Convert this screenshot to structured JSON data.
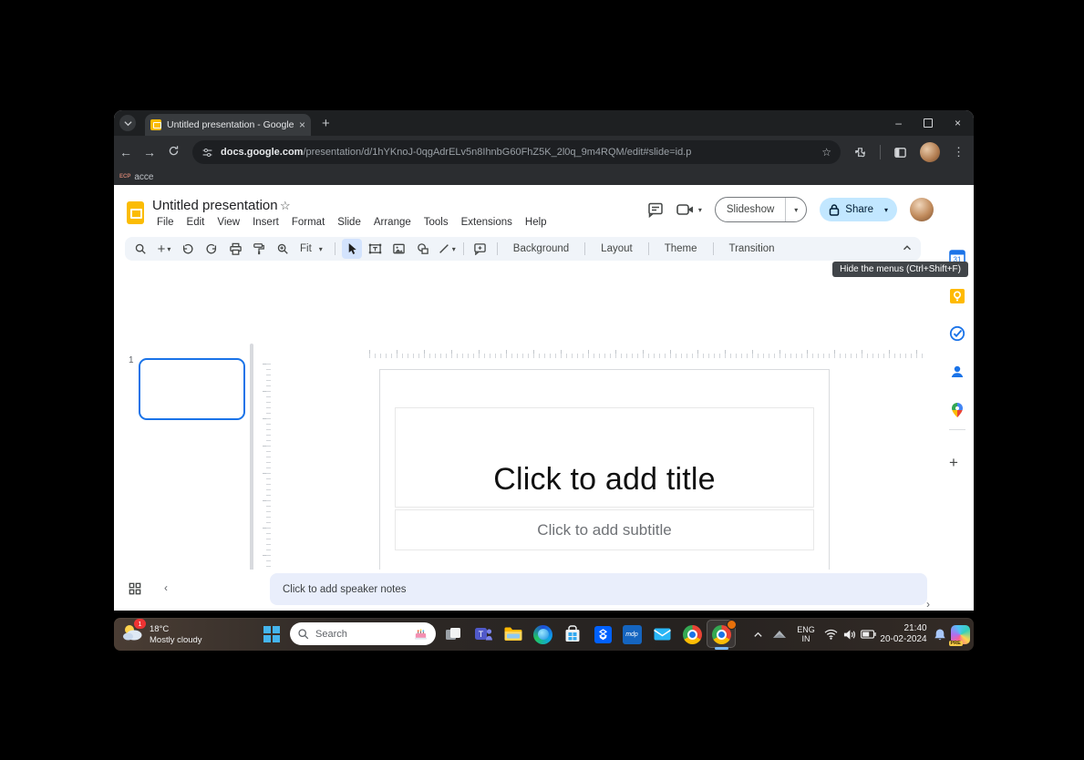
{
  "browser": {
    "tab_title": "Untitled presentation - Google",
    "tab_close": "×",
    "new_tab": "+",
    "url_domain": "docs.google.com",
    "url_path": "/presentation/d/1hYKnoJ-0qgAdrELv5n8IhnbG60FhZ5K_2l0q_9m4RQM/edit#slide=id.p",
    "bookmark_favicon": "ECP",
    "bookmark_label": "acce",
    "minimize": "–",
    "close": "×"
  },
  "slides": {
    "doc_title": "Untitled presentation",
    "star": "☆",
    "menus": [
      "File",
      "Edit",
      "View",
      "Insert",
      "Format",
      "Slide",
      "Arrange",
      "Tools",
      "Extensions",
      "Help"
    ],
    "slideshow_label": "Slideshow",
    "share_label": "Share",
    "zoom_value": "Fit",
    "toolbar_buttons": [
      "Background",
      "Layout",
      "Theme",
      "Transition"
    ],
    "hide_menus_tooltip": "Hide the menus (Ctrl+Shift+F)",
    "slide_number": "1",
    "title_placeholder": "Click to add title",
    "subtitle_placeholder": "Click to add subtitle",
    "notes_placeholder": "Click to add speaker notes",
    "calendar_day": "31"
  },
  "taskbar": {
    "weather_temp": "18°C",
    "weather_condition": "Mostly cloudy",
    "weather_badge": "1",
    "search_placeholder": "Search",
    "lang_line1": "ENG",
    "lang_line2": "IN",
    "time": "21:40",
    "date": "20-02-2024",
    "copilot_badge": "PRE"
  },
  "colors": {
    "accent_blue": "#1a73e8",
    "share_bg": "#c2e7ff",
    "selected_tool_bg": "#d3e3fd",
    "slides_yellow": "#fbbc04"
  }
}
